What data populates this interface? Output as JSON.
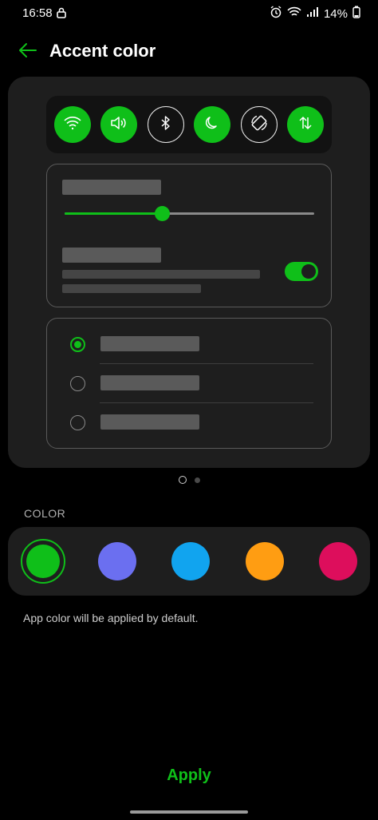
{
  "status_bar": {
    "time": "16:58",
    "battery": "14%",
    "icons": [
      "lock-icon",
      "alarm-icon",
      "wifi-icon",
      "signal-icon",
      "battery-icon"
    ]
  },
  "header": {
    "title": "Accent color",
    "back_icon": "arrow-left-icon"
  },
  "preview": {
    "quick_settings": [
      {
        "icon": "wifi-icon",
        "state": "on"
      },
      {
        "icon": "volume-icon",
        "state": "on"
      },
      {
        "icon": "bluetooth-icon",
        "state": "off"
      },
      {
        "icon": "moon-icon",
        "state": "on"
      },
      {
        "icon": "auto-rotate-icon",
        "state": "off"
      },
      {
        "icon": "data-transfer-icon",
        "state": "on"
      }
    ],
    "slider_value": 0.39,
    "toggle_on": true,
    "radio_selected_index": 0
  },
  "color_section": {
    "label": "COLOR",
    "swatches": [
      {
        "color": "#0fbf19",
        "selected": true
      },
      {
        "color": "#6b6ff0",
        "selected": false
      },
      {
        "color": "#11a4ef",
        "selected": false
      },
      {
        "color": "#ff9d12",
        "selected": false
      },
      {
        "color": "#dd0e5c",
        "selected": false
      }
    ],
    "hint": "App color will be applied by default."
  },
  "footer": {
    "apply_label": "Apply"
  },
  "colors": {
    "accent": "#0fbf19",
    "background": "#000000",
    "card": "#1e1e1e"
  }
}
